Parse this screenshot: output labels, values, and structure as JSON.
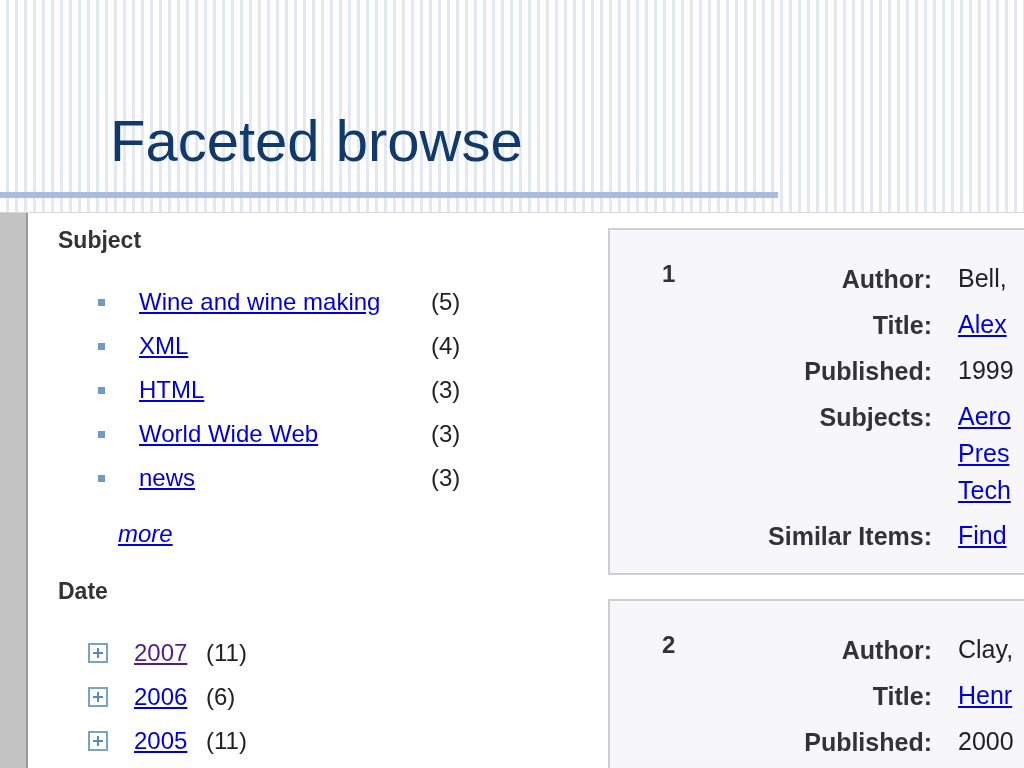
{
  "slide": {
    "title": "Faceted browse"
  },
  "facets": [
    {
      "heading": "Subject",
      "kind": "list",
      "more": "more",
      "items": [
        {
          "label": "Wine and wine making",
          "count": "(5)",
          "visited": false
        },
        {
          "label": "XML",
          "count": "(4)",
          "visited": false
        },
        {
          "label": "HTML",
          "count": "(3)",
          "visited": false
        },
        {
          "label": "World Wide Web",
          "count": "(3)",
          "visited": false
        },
        {
          "label": "news",
          "count": "(3)",
          "visited": false
        }
      ]
    },
    {
      "heading": "Date",
      "kind": "tree",
      "items": [
        {
          "label": "2007",
          "count": "(11)",
          "visited": true,
          "expanded": false
        },
        {
          "label": "2006",
          "count": "(6)",
          "visited": false,
          "expanded": false
        },
        {
          "label": "2005",
          "count": "(11)",
          "visited": false,
          "expanded": false
        }
      ]
    }
  ],
  "results": [
    {
      "number": "1",
      "fields": [
        {
          "label": "Author:",
          "values": [
            {
              "text": "Bell,",
              "link": false
            }
          ]
        },
        {
          "label": "Title:",
          "values": [
            {
              "text": "Alex",
              "link": true
            }
          ]
        },
        {
          "label": "Published:",
          "values": [
            {
              "text": "1999",
              "link": false
            }
          ]
        },
        {
          "label": "Subjects:",
          "values": [
            {
              "text": "Aero",
              "link": true
            },
            {
              "text": "Pres",
              "link": true
            },
            {
              "text": "Tech",
              "link": true
            }
          ]
        },
        {
          "label": "Similar Items:",
          "values": [
            {
              "text": "Find",
              "link": true
            }
          ]
        }
      ]
    },
    {
      "number": "2",
      "fields": [
        {
          "label": "Author:",
          "values": [
            {
              "text": "Clay,",
              "link": false
            }
          ]
        },
        {
          "label": "Title:",
          "values": [
            {
              "text": "Henr",
              "link": true
            }
          ]
        },
        {
          "label": "Published:",
          "values": [
            {
              "text": "2000",
              "link": false
            }
          ]
        }
      ]
    }
  ]
}
